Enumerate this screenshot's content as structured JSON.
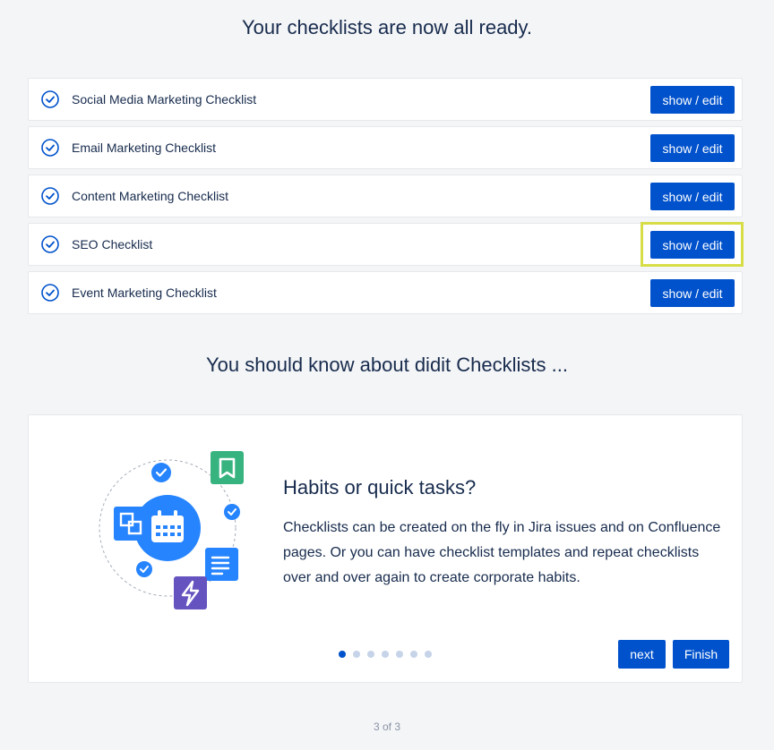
{
  "headings": {
    "top": "Your checklists are now all ready.",
    "mid": "You should know about didit Checklists ..."
  },
  "checklists": [
    {
      "label": "Social Media Marketing Checklist",
      "button": "show / edit"
    },
    {
      "label": "Email Marketing Checklist",
      "button": "show / edit"
    },
    {
      "label": "Content Marketing Checklist",
      "button": "show / edit"
    },
    {
      "label": "SEO Checklist",
      "button": "show / edit"
    },
    {
      "label": "Event Marketing Checklist",
      "button": "show / edit"
    }
  ],
  "card": {
    "title": "Habits or quick tasks?",
    "body": "Checklists can be created on the fly in Jira issues and on Confluence pages. Or you can have checklist templates and repeat checklists over and over again to create corporate habits.",
    "next_label": "next",
    "finish_label": "Finish",
    "slides_total": 7,
    "slide_active": 1
  },
  "pager": "3 of 3",
  "colors": {
    "accent": "#0052cc",
    "highlight": "#d7dd47",
    "green": "#36b37e",
    "purple": "#6554c0",
    "blue_light": "#2684ff"
  },
  "icons": {
    "row_check": "check-circle-icon",
    "illustration": [
      "calendar-icon",
      "bookmark-icon",
      "document-icon",
      "lightning-icon",
      "copy-icon",
      "check-badge-icon"
    ]
  }
}
